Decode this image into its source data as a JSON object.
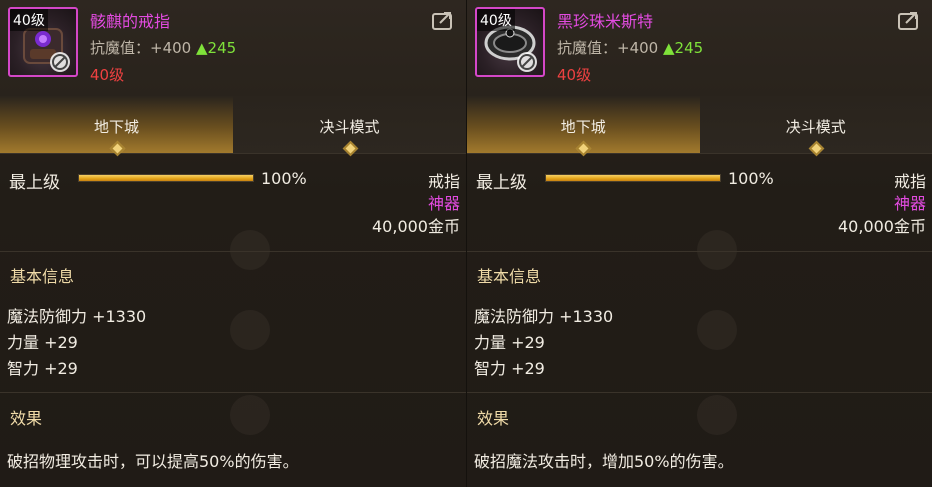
{
  "panels": [
    {
      "item": {
        "level_tag": "40级",
        "name": "骸麒的戒指",
        "anti_magic_label": "抗魔值：",
        "anti_magic_value": "+400",
        "anti_magic_up": "▲245",
        "required_level": "40级",
        "icon": "ring-icon"
      },
      "tabs": [
        "地下城",
        "决斗模式"
      ],
      "active_tab": 0,
      "rank_label": "最上级",
      "rank_percent": "100%",
      "rank_fill": 1.0,
      "category": "戒指",
      "rarity": "神器",
      "rarity_color": "#e24be0",
      "price": "40,000金币",
      "basic_info_title": "基本信息",
      "stats": [
        "魔法防御力 +1330",
        "力量 +29",
        "智力 +29"
      ],
      "effect_title": "效果",
      "effect_text": "破招物理攻击时，可以提高50%的伤害。"
    },
    {
      "item": {
        "level_tag": "40级",
        "name": "黑珍珠米斯特",
        "anti_magic_label": "抗魔值：",
        "anti_magic_value": "+400",
        "anti_magic_up": "▲245",
        "required_level": "40级",
        "icon": "bracelet-icon"
      },
      "tabs": [
        "地下城",
        "决斗模式"
      ],
      "active_tab": 0,
      "rank_label": "最上级",
      "rank_percent": "100%",
      "rank_fill": 1.0,
      "category": "戒指",
      "rarity": "神器",
      "rarity_color": "#e24be0",
      "price": "40,000金币",
      "basic_info_title": "基本信息",
      "stats": [
        "魔法防御力 +1330",
        "力量 +29",
        "智力 +29"
      ],
      "effect_title": "效果",
      "effect_text": "破招魔法攻击时，增加50%的伤害。"
    }
  ],
  "colors": {
    "item_name": "#e24be0",
    "required_level": "#ee4141",
    "stat_up": "#7fe23a",
    "section_title": "#f0dba8"
  }
}
